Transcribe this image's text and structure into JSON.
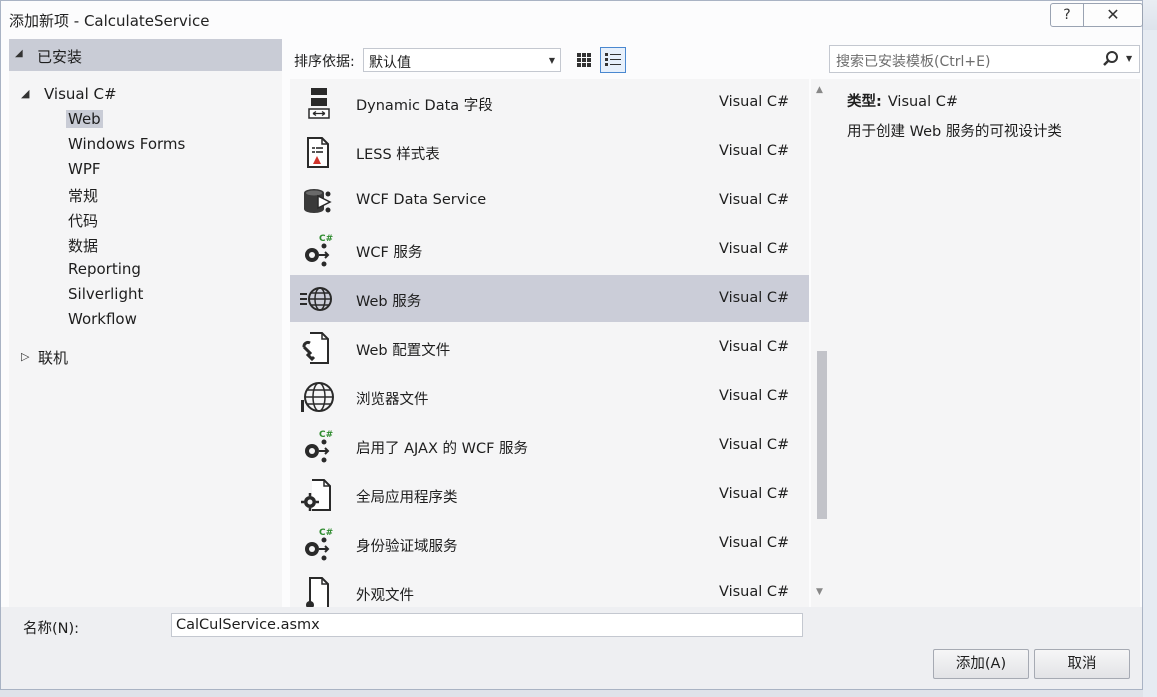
{
  "window": {
    "title": "添加新项 - CalculateService",
    "help_glyph": "?",
    "close_glyph": "✕"
  },
  "left": {
    "installed": "已安装",
    "visual_csharp": "Visual C#",
    "children": [
      "Web",
      "Windows Forms",
      "WPF",
      "常规",
      "代码",
      "数据",
      "Reporting",
      "Silverlight",
      "Workflow"
    ],
    "online": "联机"
  },
  "toolbar": {
    "sort_label": "排序依据:",
    "sort_value": "默认值"
  },
  "search": {
    "placeholder": "搜索已安装模板(Ctrl+E)"
  },
  "templates": [
    {
      "name": "Dynamic Data 字段",
      "lang": "Visual C#",
      "icon": "dynamic-data-icon"
    },
    {
      "name": "LESS 样式表",
      "lang": "Visual C#",
      "icon": "less-stylesheet-icon"
    },
    {
      "name": "WCF Data Service",
      "lang": "Visual C#",
      "icon": "data-service-icon"
    },
    {
      "name": "WCF 服务",
      "lang": "Visual C#",
      "icon": "wcf-service-icon"
    },
    {
      "name": "Web 服务",
      "lang": "Visual C#",
      "icon": "web-service-icon"
    },
    {
      "name": "Web 配置文件",
      "lang": "Visual C#",
      "icon": "web-config-icon"
    },
    {
      "name": "浏览器文件",
      "lang": "Visual C#",
      "icon": "browser-file-icon"
    },
    {
      "name": "启用了 AJAX 的 WCF 服务",
      "lang": "Visual C#",
      "icon": "ajax-wcf-service-icon"
    },
    {
      "name": "全局应用程序类",
      "lang": "Visual C#",
      "icon": "global-app-class-icon"
    },
    {
      "name": "身份验证域服务",
      "lang": "Visual C#",
      "icon": "auth-domain-service-icon"
    },
    {
      "name": "外观文件",
      "lang": "Visual C#",
      "icon": "skin-file-icon"
    }
  ],
  "selected_template": "Web 服务",
  "info": {
    "type_label": "类型:",
    "type_value": "Visual C#",
    "description": "用于创建 Web 服务的可视设计类"
  },
  "bottom": {
    "name_label": "名称(N):",
    "name_value": "CalCulService.asmx",
    "add_label": "添加(A)",
    "cancel_label": "取消"
  },
  "colors": {
    "selection": "#cbcdd8",
    "accent": "#4a88d0",
    "pane_bg": "#f5f5f6"
  }
}
